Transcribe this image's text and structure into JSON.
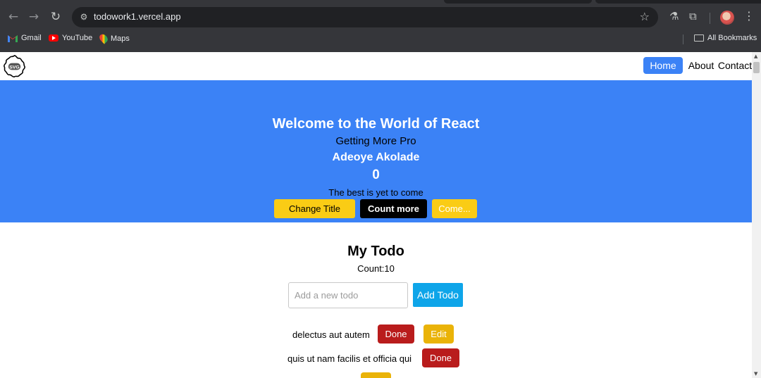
{
  "browser": {
    "url": "todowork1.vercel.app",
    "bookmarks": [
      {
        "label": "Gmail",
        "icon": "gmail-icon"
      },
      {
        "label": "YouTube",
        "icon": "youtube-icon"
      },
      {
        "label": "Maps",
        "icon": "maps-icon"
      }
    ],
    "all_bookmarks": "All Bookmarks"
  },
  "navbar": {
    "logo_text": "SVG",
    "links": [
      "Home",
      "About",
      "Contact"
    ],
    "active_link": "Home"
  },
  "hero": {
    "title": "Welcome to the World of React",
    "subtitle": "Getting More Pro",
    "name": "Adeoye Akolade",
    "count": "0",
    "tagline": "The best is yet to come",
    "buttons": [
      "Change Title",
      "Count more",
      "Come..."
    ]
  },
  "todo": {
    "title": "My Todo",
    "count_label": "Count:10",
    "input_placeholder": "Add a new todo",
    "add_button": "Add Todo",
    "items": [
      {
        "text": "delectus aut autem",
        "done_label": "Done",
        "edit_label": "Edit"
      },
      {
        "text": "quis ut nam facilis et officia qui",
        "done_label": "Done",
        "edit_label": ""
      }
    ]
  },
  "colors": {
    "hero_bg": "#3b82f6",
    "nav_active": "#3b82f6",
    "yellow": "#facc15",
    "done_red": "#b91c1c",
    "edit_yellow": "#eab308",
    "add_blue": "#0ea5e9"
  }
}
